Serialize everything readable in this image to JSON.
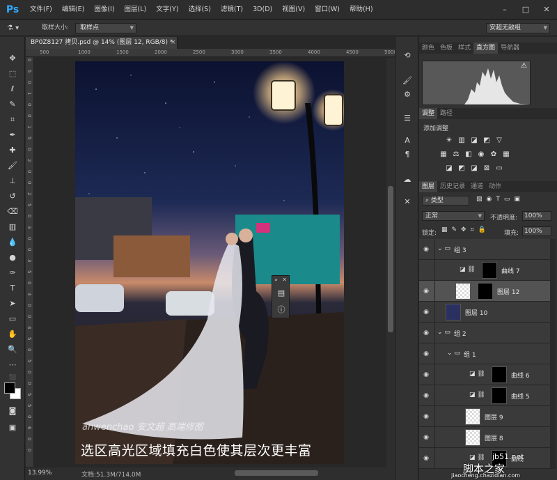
{
  "app": {
    "logo": "Ps"
  },
  "menu": [
    "文件(F)",
    "编辑(E)",
    "图像(I)",
    "图层(L)",
    "文字(Y)",
    "选择(S)",
    "滤镜(T)",
    "3D(D)",
    "视图(V)",
    "窗口(W)",
    "帮助(H)"
  ],
  "window_controls": {
    "minimize": "–",
    "maximize": "□",
    "close": "✕"
  },
  "options": {
    "sample_size_label": "取样大小:",
    "sample_size_value": "取样点",
    "workspace": "安超无敌组"
  },
  "document": {
    "tab_title": "BP0Z8127 拷贝.psd @ 14% (图层 12, RGB/8) *",
    "close": "×",
    "zoom": "13.99%",
    "doc_info": "文档:51.3M/714.0M"
  },
  "rulers": {
    "h": [
      "500",
      "1000",
      "1500",
      "2000",
      "2500",
      "3000",
      "3500",
      "4000",
      "4500",
      "5000"
    ],
    "v": [
      "0",
      "5",
      "0",
      "1",
      "0",
      "0",
      "1",
      "5",
      "0",
      "2",
      "0",
      "0",
      "2",
      "5",
      "0",
      "3",
      "0",
      "0",
      "3",
      "5",
      "0",
      "4",
      "0",
      "0",
      "4",
      "5",
      "0",
      "5",
      "0",
      "0",
      "5",
      "5",
      "0",
      "6",
      "0",
      "0"
    ]
  },
  "overlay_panel": {
    "collapse": "»",
    "close": "✕"
  },
  "image_text": {
    "caption": "选区高光区域填充白色使其层次更丰富",
    "watermark": "anwenchao 安文超 高端修图"
  },
  "panels": {
    "top_tabs": [
      "颜色",
      "色板",
      "样式",
      "直方图",
      "导航器"
    ],
    "top_active": "直方图",
    "adj_tabs": [
      "调整",
      "路径"
    ],
    "adj_active": "调整",
    "adj_title": "添加调整",
    "layer_tabs": [
      "图层",
      "历史记录",
      "通道",
      "动作"
    ],
    "layer_active": "图层",
    "filter_kind": "类型",
    "blend_mode": "正常",
    "opacity_label": "不透明度:",
    "opacity": "100%",
    "lock_label": "锁定:",
    "fill_label": "填充:",
    "fill": "100%"
  },
  "layers": [
    {
      "name": "组 3",
      "type": "group",
      "visible": true
    },
    {
      "name": "曲线 7",
      "type": "adjust",
      "visible": false
    },
    {
      "name": "图层 12",
      "type": "pixel-mask",
      "visible": true,
      "selected": true
    },
    {
      "name": "图层 10",
      "type": "pixel",
      "visible": true
    },
    {
      "name": "组 2",
      "type": "group",
      "visible": true
    },
    {
      "name": "组 1",
      "type": "group",
      "visible": true
    },
    {
      "name": "曲线 6",
      "type": "adjust",
      "visible": true
    },
    {
      "name": "曲线 5",
      "type": "adjust",
      "visible": true
    },
    {
      "name": "图层 9",
      "type": "pixel",
      "visible": true
    },
    {
      "name": "图层 8",
      "type": "pixel",
      "visible": true
    },
    {
      "name": "曲线",
      "type": "adjust",
      "visible": true
    }
  ],
  "watermark_site": {
    "domain": "jb51.net",
    "name": "脚本之家",
    "sub": "jiaocheng.chazidian.com"
  }
}
